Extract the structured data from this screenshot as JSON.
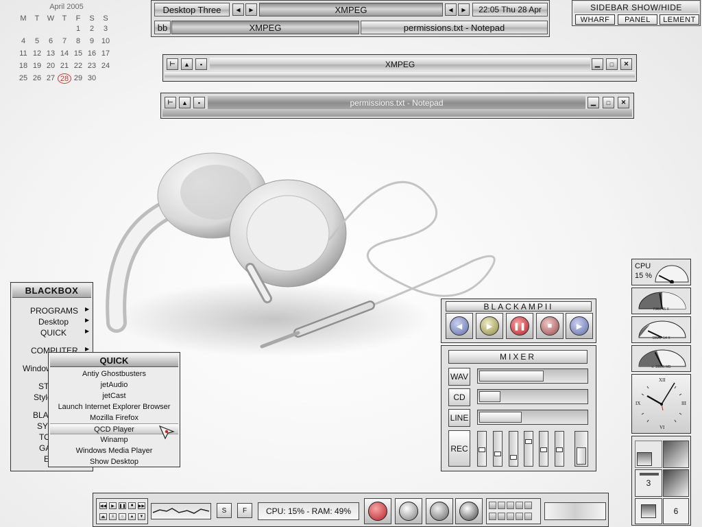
{
  "calendar": {
    "month": "April 2005",
    "weekdays": [
      "M",
      "T",
      "W",
      "T",
      "F",
      "S",
      "S"
    ],
    "weeks": [
      [
        "",
        "",
        "",
        "",
        "1",
        "2",
        "3"
      ],
      [
        "4",
        "5",
        "6",
        "7",
        "8",
        "9",
        "10"
      ],
      [
        "11",
        "12",
        "13",
        "14",
        "15",
        "16",
        "17"
      ],
      [
        "18",
        "19",
        "20",
        "21",
        "22",
        "23",
        "24"
      ],
      [
        "25",
        "26",
        "27",
        "28",
        "29",
        "30",
        ""
      ]
    ],
    "today": "28"
  },
  "toolbar": {
    "workspace": "Desktop Three",
    "active_window": "XMPEG",
    "clock": "22:05 Thu 28 Apr",
    "bb_label": "bb",
    "task1": "XMPEG",
    "task2": "permissions.txt - Notepad"
  },
  "sidebar": {
    "title": "SIDEBAR SHOW/HIDE",
    "buttons": [
      "WHARF",
      "PANEL",
      "LEMENT"
    ]
  },
  "windows": {
    "xmpeg": {
      "title": "XMPEG"
    },
    "notepad": {
      "title": "permissions.txt - Notepad"
    }
  },
  "blackbox_menu": {
    "title": "BLACKBOX",
    "items": [
      "PROGRAMS",
      "Desktop",
      "QUICK",
      "COMPUTER",
      "Window",
      "ST",
      "Style",
      "BLAC",
      "SYS",
      "TO",
      "GA",
      "E"
    ]
  },
  "quick_menu": {
    "title": "QUICK",
    "items": [
      "Antiy Ghostbusters",
      "jetAudio",
      "jetCast",
      "Launch Internet Explorer Browser",
      "Mozilla Firefox",
      "QCD Player",
      "Winamp",
      "Windows Media Player",
      "Show Desktop"
    ],
    "selected_index": 5
  },
  "blackamp": {
    "title": "BLACKAMPII",
    "buttons": [
      "prev-icon",
      "play-icon",
      "pause-icon",
      "stop-icon",
      "next-icon"
    ]
  },
  "mixer": {
    "title": "MIXER",
    "channels": [
      {
        "label": "WAV",
        "level": 0.6
      },
      {
        "label": "CD",
        "level": 0.2
      },
      {
        "label": "LINE",
        "level": 0.4
      }
    ],
    "rec_label": "REC",
    "rec_sliders": [
      0.45,
      0.3,
      0.2,
      0.75,
      0.45,
      0.45
    ],
    "master_level": 0.55
  },
  "monitors": {
    "cpu_label": "CPU",
    "cpu_value": "15 %",
    "cpu_level": 0.15,
    "ram_label": "RAM 45 X",
    "ram_level": 0.45,
    "swap_label": "SWAP 14 X",
    "swap_level": 0.14,
    "disk_label": "c: 16856 MB",
    "disk_level": 0.35
  },
  "clock_face": {
    "numerals": [
      "XII",
      "III",
      "VI",
      "IX"
    ]
  },
  "pager": {
    "labels": [
      "3",
      "6"
    ]
  },
  "taskbar": {
    "mini_buttons": [
      "S",
      "F"
    ],
    "stats": "CPU: 15% - RAM: 49%"
  },
  "colors": {
    "amp_red": "#b8202a",
    "amp_blue": "#5f6ea8",
    "amp_olive": "#8e8a45"
  }
}
